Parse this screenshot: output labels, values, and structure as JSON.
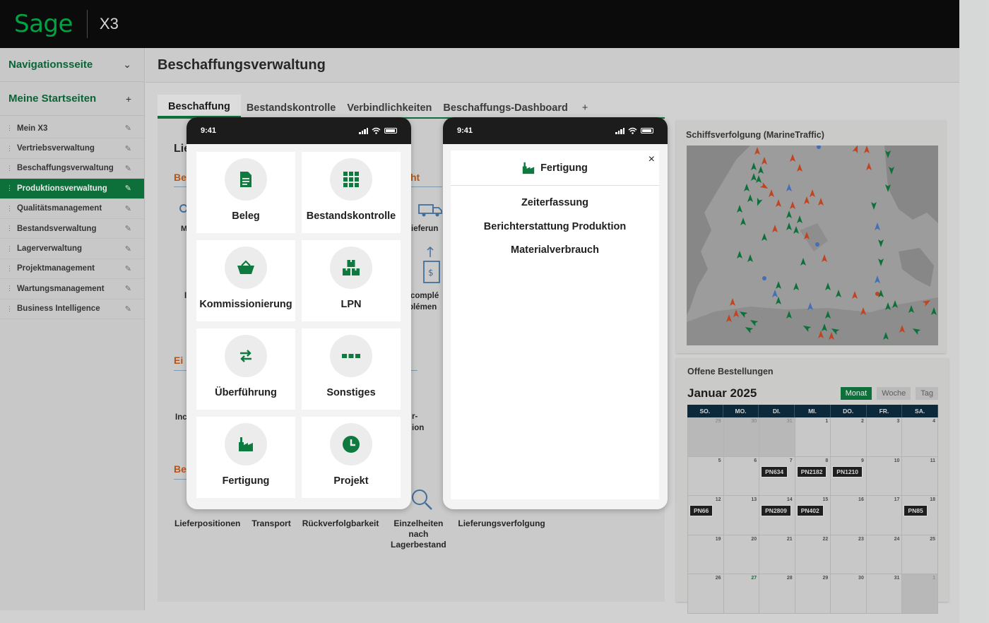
{
  "app": {
    "logo": "Sage",
    "product": "X3"
  },
  "sidebar": {
    "nav_label": "Navigationsseite",
    "nav_toggle": "⌄",
    "home_label": "Meine Startseiten",
    "home_add": "+",
    "items": [
      {
        "label": "Mein X3"
      },
      {
        "label": "Vertriebsverwaltung"
      },
      {
        "label": "Beschaffungsverwaltung"
      },
      {
        "label": "Produktionsverwaltung"
      },
      {
        "label": "Qualitätsmanagement"
      },
      {
        "label": "Bestandsverwaltung"
      },
      {
        "label": "Lagerverwaltung"
      },
      {
        "label": "Projektmanagement"
      },
      {
        "label": "Wartungsmanagement"
      },
      {
        "label": "Business Intelligence"
      }
    ],
    "active_index": 3
  },
  "page": {
    "title": "Beschaffungsverwaltung"
  },
  "tabs": [
    {
      "label": "Beschaffung"
    },
    {
      "label": "Bestandskontrolle"
    },
    {
      "label": "Verbindlichkeiten"
    },
    {
      "label": "Beschaffungs-Dashboard"
    },
    {
      "label": "+"
    }
  ],
  "background": {
    "fragments": [
      "Lie",
      "Be",
      "ht",
      "M",
      "ieferun",
      "I",
      "complé",
      "plémen",
      "Ei",
      "Inc",
      "r-",
      "ion",
      "Be"
    ],
    "bottom_labels": [
      "Lieferpositionen",
      "Transport",
      "Rückverfolgbarkeit",
      "Einzelheiten nach Lagerbestand",
      "Lieferungsverfolgung"
    ]
  },
  "phone_left": {
    "time": "9:41",
    "tiles": [
      {
        "label": "Beleg",
        "icon": "document-icon"
      },
      {
        "label": "Bestandskontrolle",
        "icon": "grid-icon"
      },
      {
        "label": "Kommissionierung",
        "icon": "basket-icon"
      },
      {
        "label": "LPN",
        "icon": "boxes-icon"
      },
      {
        "label": "Überführung",
        "icon": "transfer-icon"
      },
      {
        "label": "Sonstiges",
        "icon": "more-icon"
      },
      {
        "label": "Fertigung",
        "icon": "factory-icon"
      },
      {
        "label": "Projekt",
        "icon": "clock-icon"
      }
    ]
  },
  "phone_right": {
    "time": "9:41",
    "sheet_title": "Fertigung",
    "close": "×",
    "items": [
      {
        "label": "Zeiterfassung"
      },
      {
        "label": "Berichterstattung Produktion"
      },
      {
        "label": "Materialverbrauch"
      }
    ]
  },
  "ship_panel": {
    "title": "Schiffsverfolgung (MarineTraffic)"
  },
  "orders": {
    "title": "Offene Bestellungen",
    "month": "Januar 2025",
    "views": [
      {
        "label": "Monat"
      },
      {
        "label": "Woche"
      },
      {
        "label": "Tag"
      }
    ],
    "active_view": 0,
    "weekdays": [
      "SO.",
      "MO.",
      "DI.",
      "MI.",
      "DO.",
      "FR.",
      "SA."
    ],
    "weeks": [
      [
        {
          "d": "29",
          "o": true
        },
        {
          "d": "30",
          "o": true
        },
        {
          "d": "31",
          "o": true
        },
        {
          "d": "1"
        },
        {
          "d": "2"
        },
        {
          "d": "3"
        },
        {
          "d": "4"
        }
      ],
      [
        {
          "d": "5"
        },
        {
          "d": "6"
        },
        {
          "d": "7",
          "chip": "PN634"
        },
        {
          "d": "8",
          "chip": "PN2182"
        },
        {
          "d": "9",
          "chip": "PN1210"
        },
        {
          "d": "10"
        },
        {
          "d": "11"
        }
      ],
      [
        {
          "d": "12",
          "chip": "PN66"
        },
        {
          "d": "13"
        },
        {
          "d": "14",
          "chip": "PN2809"
        },
        {
          "d": "15",
          "chip": "PN402"
        },
        {
          "d": "16"
        },
        {
          "d": "17"
        },
        {
          "d": "18",
          "chip": "PN85"
        }
      ],
      [
        {
          "d": "19"
        },
        {
          "d": "20"
        },
        {
          "d": "21"
        },
        {
          "d": "22"
        },
        {
          "d": "23"
        },
        {
          "d": "24"
        },
        {
          "d": "25"
        }
      ],
      [
        {
          "d": "26"
        },
        {
          "d": "27",
          "today": true
        },
        {
          "d": "28"
        },
        {
          "d": "29"
        },
        {
          "d": "30"
        },
        {
          "d": "31"
        },
        {
          "d": "1",
          "o": true
        }
      ]
    ]
  },
  "colors": {
    "brand": "#00b14a",
    "accent": "#0f7a3f",
    "orange": "#c65b1c",
    "ship_red": "#d24a24",
    "ship_green": "#0f7a3f",
    "ship_blue": "#4a78c8"
  }
}
